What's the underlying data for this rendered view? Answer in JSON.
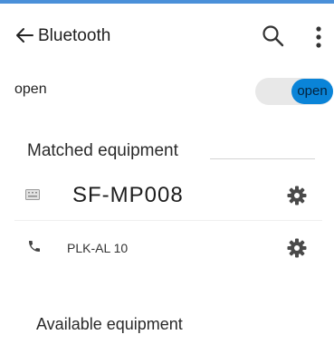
{
  "header": {
    "title": "Bluetooth",
    "back_icon": "back-arrow-icon",
    "search_icon": "search-icon",
    "more_icon": "more-vert-icon",
    "accent_color": "#4a90d9"
  },
  "bluetooth_toggle": {
    "label": "open",
    "state_label": "open",
    "on": true,
    "on_color": "#0a84d8"
  },
  "matched": {
    "title": "Matched equipment",
    "devices": [
      {
        "name": "SF-MP008",
        "type_icon": "keyboard-icon",
        "settings_icon": "gear-icon"
      },
      {
        "name": "PLK-AL 10",
        "type_icon": "phone-icon",
        "settings_icon": "gear-icon"
      }
    ]
  },
  "available": {
    "title": "Available equipment"
  }
}
